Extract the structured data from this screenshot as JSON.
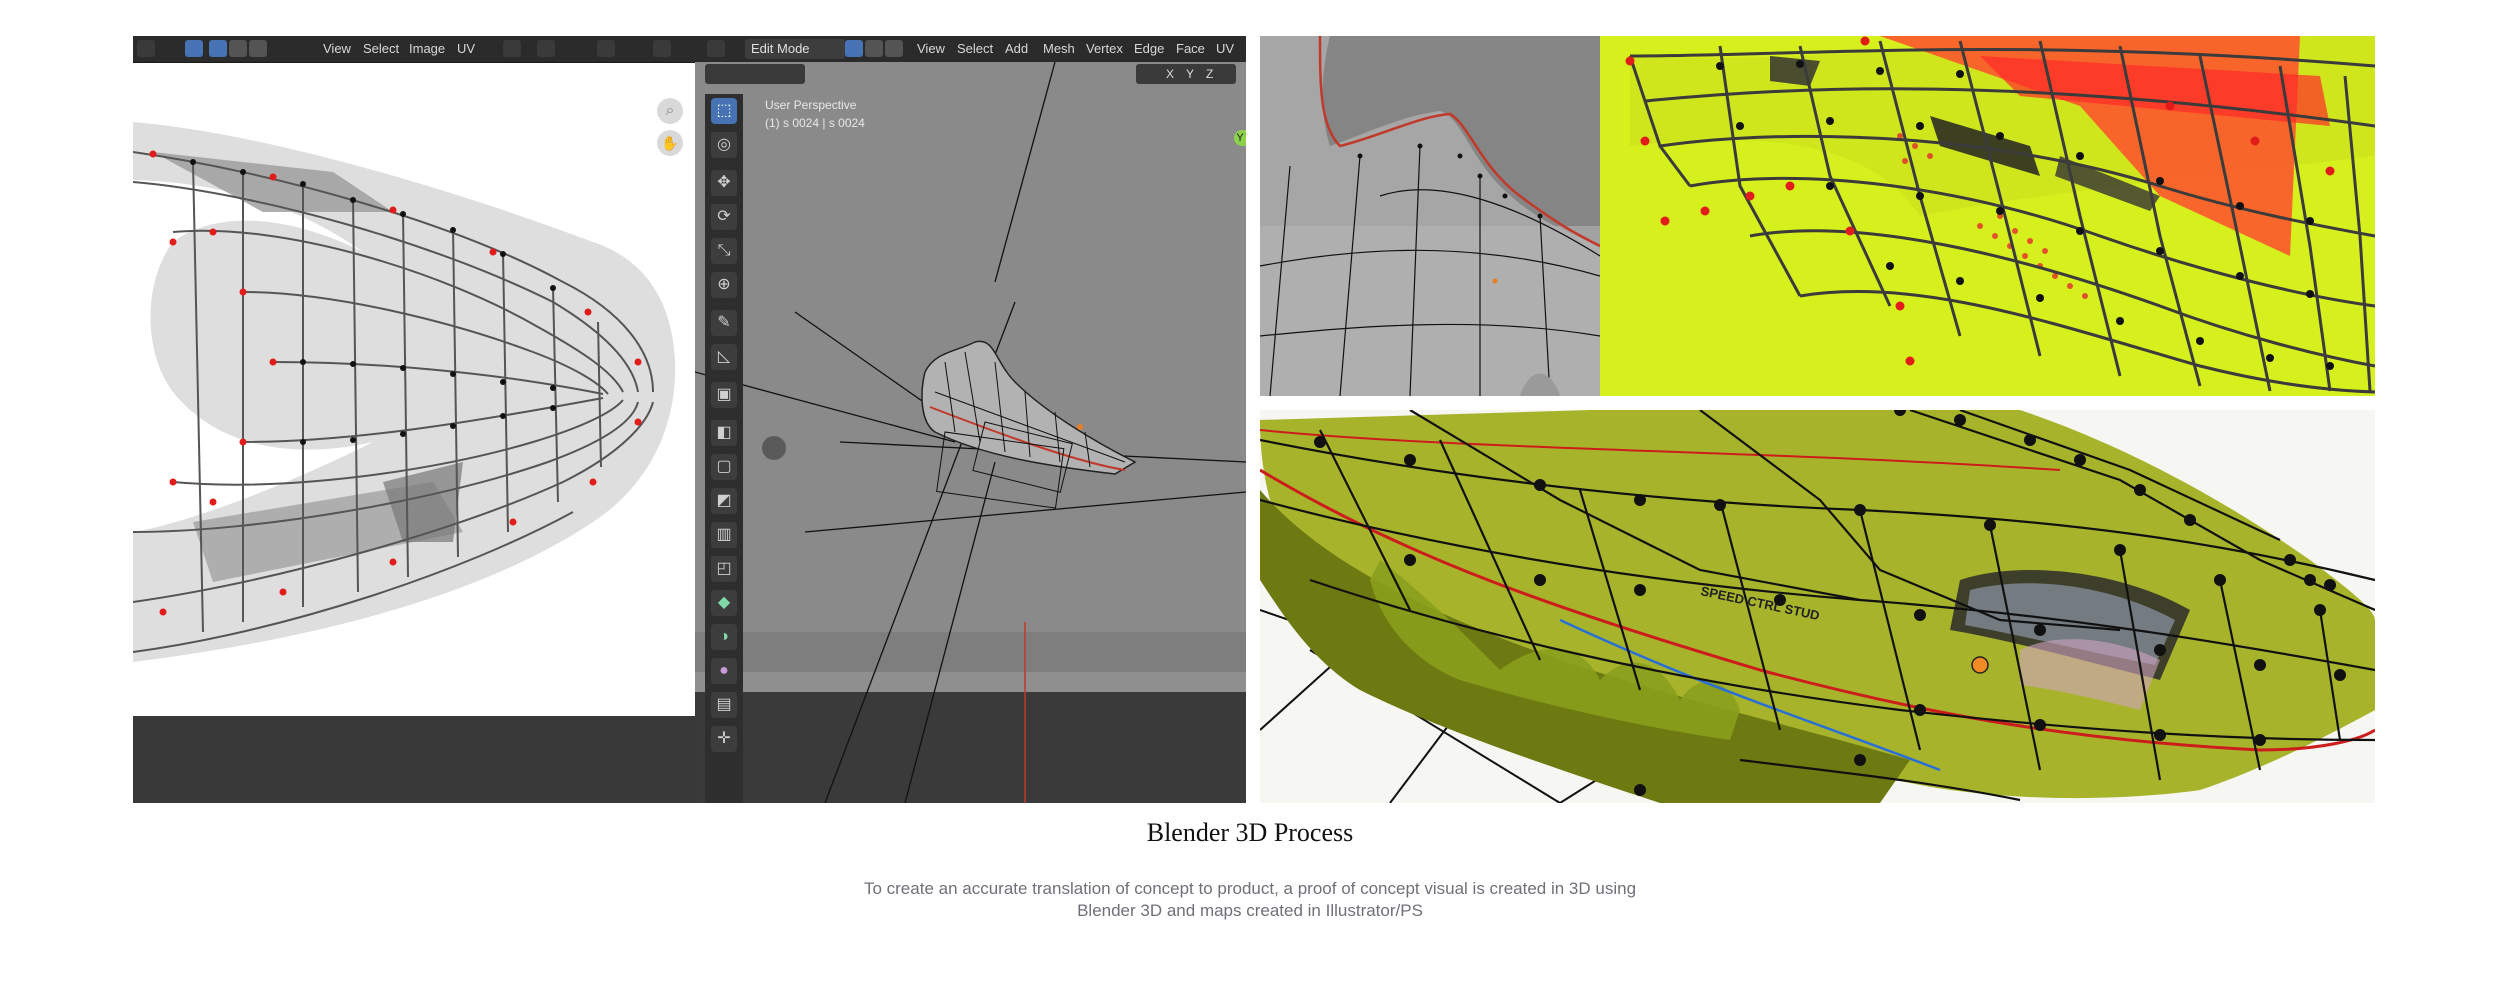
{
  "uv_editor": {
    "menu": [
      "View",
      "Select",
      "Image",
      "UV"
    ]
  },
  "viewport": {
    "mode": "Edit Mode",
    "menu": [
      "View",
      "Select",
      "Add",
      "Mesh",
      "Vertex",
      "Edge",
      "Face",
      "UV"
    ],
    "axes": [
      "X",
      "Y",
      "Z"
    ],
    "perspective": "User Perspective",
    "object_info": "(1) s 0024 | s 0024",
    "axis_gizmo_label": "Y",
    "tools": [
      "select-box",
      "cursor",
      "move",
      "rotate",
      "scale",
      "transform",
      "annotate",
      "measure",
      "add-cube",
      "extrude",
      "inset",
      "bevel",
      "loop-cut",
      "knife",
      "poly-build",
      "spin",
      "smooth",
      "shrink-fatten",
      "shear"
    ]
  },
  "render_closeup": {
    "print_text": "SPEED CTRL STUD"
  },
  "colors": {
    "uv_accent": "#ff2a2a",
    "lime": "#d6f01e",
    "blender_blue": "#4772b3"
  },
  "caption": {
    "title": "Blender 3D Process",
    "body": "To create an accurate translation of concept to product, a proof of concept visual is created in 3D using Blender 3D and maps created in Illustrator/PS"
  }
}
